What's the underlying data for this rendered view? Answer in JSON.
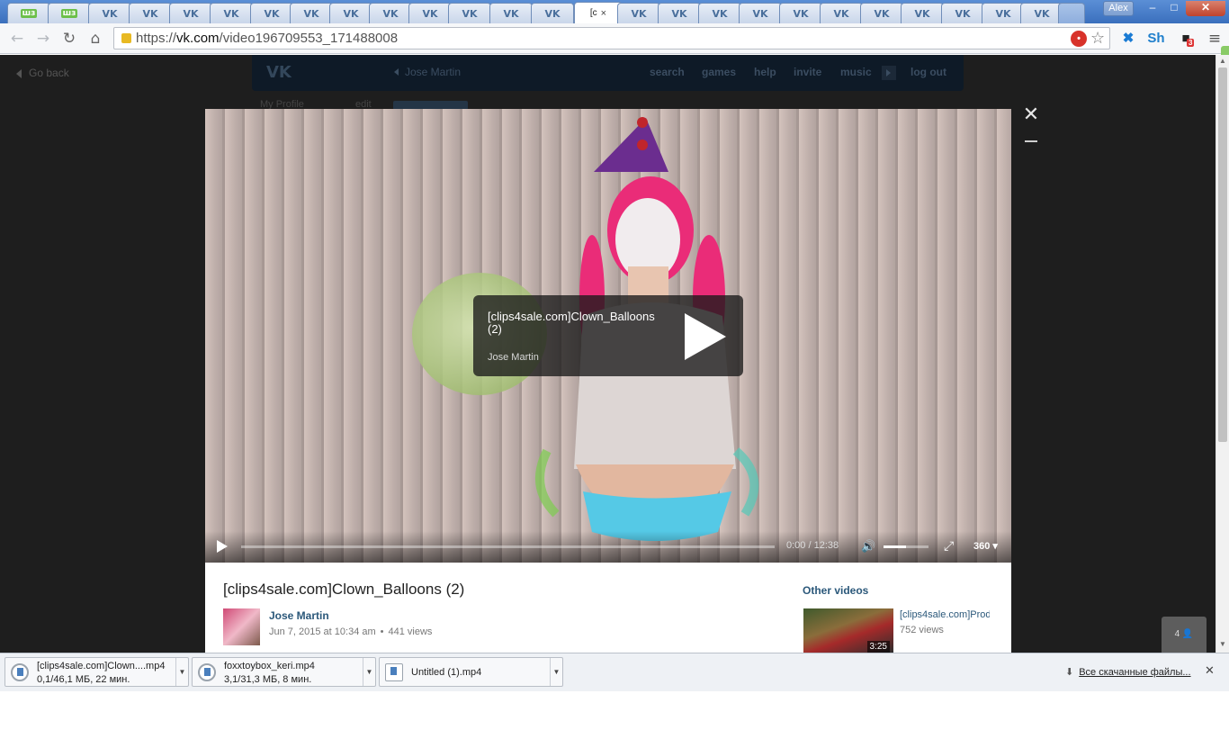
{
  "browser": {
    "tabs": [
      {
        "icon": "vk-green-icon",
        "glyph": "шз"
      },
      {
        "icon": "vk-green-icon",
        "glyph": "шз"
      },
      {
        "icon": "vk-icon",
        "glyph": "VK"
      },
      {
        "icon": "vk-icon",
        "glyph": "VK"
      },
      {
        "icon": "vk-icon",
        "glyph": "VK"
      },
      {
        "icon": "vk-icon",
        "glyph": "VK"
      },
      {
        "icon": "vk-icon",
        "glyph": "VK"
      },
      {
        "icon": "vk-icon",
        "glyph": "VK"
      },
      {
        "icon": "vk-icon",
        "glyph": "VK"
      },
      {
        "icon": "vk-icon",
        "glyph": "VK"
      },
      {
        "icon": "vk-icon",
        "glyph": "VK"
      },
      {
        "icon": "vk-icon",
        "glyph": "VK"
      },
      {
        "icon": "vk-icon",
        "glyph": "VK"
      },
      {
        "icon": "vk-icon",
        "glyph": "VK"
      }
    ],
    "active_tab_title": "[c",
    "active_tab_close": "×",
    "tabs_after": [
      "VK",
      "VK",
      "VK",
      "VK",
      "VK",
      "VK",
      "VK",
      "VK",
      "VK",
      "VK",
      "VK"
    ],
    "window_user": "Alex",
    "url_prefix": "https://",
    "url_host": "vk.com",
    "url_path": "/video196709553_171488008",
    "ext_badge": "3"
  },
  "vk_page": {
    "go_back": "Go back",
    "header_user": "Jose Martin",
    "nav": [
      "search",
      "games",
      "help",
      "invite",
      "music"
    ],
    "logout": "log out",
    "my_profile": "My Profile",
    "edit": "edit"
  },
  "video": {
    "card_title": "[clips4sale.com]Clown_Balloons (2)",
    "card_author": "Jose Martin",
    "time": "0:00 / 12:38",
    "quality": "360",
    "progress": 0.0,
    "volume": 0.5,
    "title": "[clips4sale.com]Clown_Balloons (2)",
    "author": "Jose Martin",
    "date": "Jun 7, 2015 at 10:34 am",
    "views": "441 views",
    "other_videos_label": "Other videos",
    "related": {
      "title": "[clips4sale.com]Produ",
      "views": "752 views",
      "duration": "3:25"
    },
    "chat_count": "4"
  },
  "downloads": [
    {
      "name": "[clips4sale.com]Clown....mp4",
      "status": "0,1/46,1 МБ, 22 мин."
    },
    {
      "name": "foxxtoybox_keri.mp4",
      "status": "3,1/31,3 МБ, 8 мин."
    },
    {
      "name": "Untitled (1).mp4",
      "status": ""
    }
  ],
  "all_downloads": "Все скачанные файлы..."
}
